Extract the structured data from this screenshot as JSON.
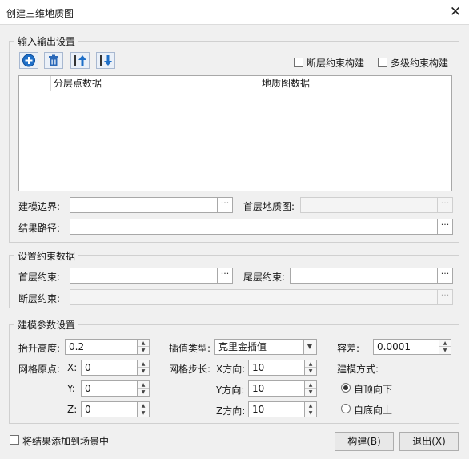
{
  "window": {
    "title": "创建三维地质图",
    "close_symbol": "✕"
  },
  "io_group": {
    "legend": "输入输出设置",
    "toolbar_icons": [
      "add-icon",
      "delete-icon",
      "move-up-icon",
      "move-down-icon"
    ],
    "fault_constraint_label": "断层约束构建",
    "multilevel_constraint_label": "多级约束构建",
    "columns": [
      "分层点数据",
      "地质图数据"
    ],
    "model_boundary_label": "建模边界:",
    "model_boundary_value": "",
    "top_geo_map_label": "首层地质图:",
    "top_geo_map_value": "",
    "result_path_label": "结果路径:",
    "result_path_value": "",
    "browse_symbol": "···"
  },
  "constraint_group": {
    "legend": "设置约束数据",
    "top_constraint_label": "首层约束:",
    "top_constraint_value": "",
    "bottom_constraint_label": "尾层约束:",
    "bottom_constraint_value": "",
    "fault_constraint_label": "断层约束:",
    "fault_constraint_value": ""
  },
  "params_group": {
    "legend": "建模参数设置",
    "lift_height_label": "抬升高度:",
    "lift_height_value": "0.2",
    "interp_type_label": "插值类型:",
    "interp_type_value": "克里金插值",
    "tolerance_label": "容差:",
    "tolerance_value": "0.0001",
    "grid_origin_label": "网格原点:",
    "x_label": "X:",
    "x_value": "0",
    "y_label": "Y:",
    "y_value": "0",
    "z_label": "Z:",
    "z_value": "0",
    "grid_step_label": "网格步长:",
    "x_dir_label": "X方向:",
    "x_dir_value": "10",
    "y_dir_label": "Y方向:",
    "y_dir_value": "10",
    "z_dir_label": "Z方向:",
    "z_dir_value": "10",
    "model_method_label": "建模方式:",
    "top_down_label": "自顶向下",
    "bottom_up_label": "自底向上"
  },
  "footer": {
    "add_to_scene_label": "将结果添加到场景中",
    "build_button": "构建(B)",
    "exit_button": "退出(X)"
  },
  "colors": {
    "accent": "#1e6fc8",
    "delete": "#2a68b8"
  }
}
